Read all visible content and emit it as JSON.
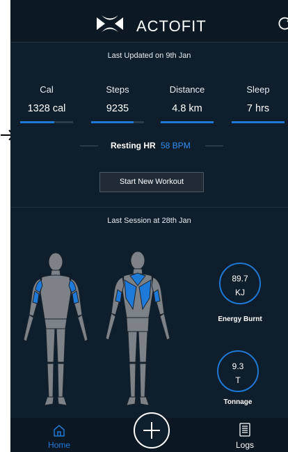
{
  "outside": {
    "arrow_icon": "arrow-right-icon"
  },
  "header": {
    "brand": "ACTOFIT",
    "logo_icon": "actofit-logo-icon",
    "refresh_icon": "refresh-icon"
  },
  "updated": "Last  Updated on 9th Jan",
  "metrics": [
    {
      "label": "Cal",
      "value": "1328 cal",
      "progress": 0.65
    },
    {
      "label": "Steps",
      "value": "9235",
      "progress": 0.8
    },
    {
      "label": "Distance",
      "value": "4.8 km",
      "progress": 1.0
    },
    {
      "label": "Sleep",
      "value": "7 hrs",
      "progress": 1.0
    }
  ],
  "resting_hr": {
    "label": "Resting HR",
    "value": "58 BPM"
  },
  "start_workout": "Start New Workout",
  "last_session": "Last  Session at 28th Jan",
  "stats": {
    "energy": {
      "value": "89.7",
      "unit": "KJ",
      "label": "Energy Burnt"
    },
    "tonnage": {
      "value": "9.3",
      "unit": "T",
      "label": "Tonnage"
    }
  },
  "nav": {
    "home": "Home",
    "logs": "Logs",
    "home_icon": "home-icon",
    "logs_icon": "logs-icon",
    "add_icon": "plus-icon"
  },
  "colors": {
    "accent": "#1e78d6",
    "background": "#0f1e2c",
    "muscle_highlight": "#1e7ad8"
  }
}
